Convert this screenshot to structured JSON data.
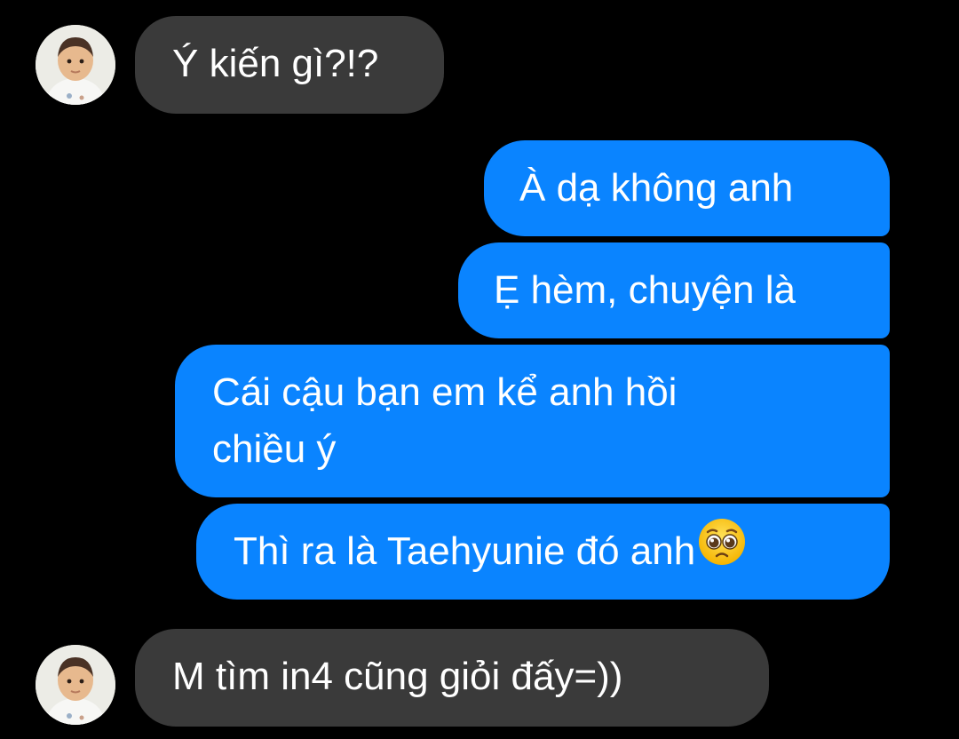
{
  "conversation": {
    "messages": [
      {
        "sender": "contact",
        "text": "Ý kiến gì?!?"
      },
      {
        "sender": "me",
        "text": "À dạ không anh"
      },
      {
        "sender": "me",
        "text": "Ẹ hèm, chuyện là"
      },
      {
        "sender": "me",
        "line1": "Cái cậu bạn em kể anh hồi",
        "line2": "chiều ý"
      },
      {
        "sender": "me",
        "text": "Thì ra là Taehyunie đó anh",
        "emoji": "pleading-face-emoji"
      },
      {
        "sender": "contact",
        "text": "M tìm in4 cũng giỏi đấy=))"
      }
    ]
  },
  "colors": {
    "background": "#000000",
    "incoming_bubble": "#3a3a3a",
    "outgoing_bubble": "#0a84ff",
    "text": "#ffffff"
  }
}
